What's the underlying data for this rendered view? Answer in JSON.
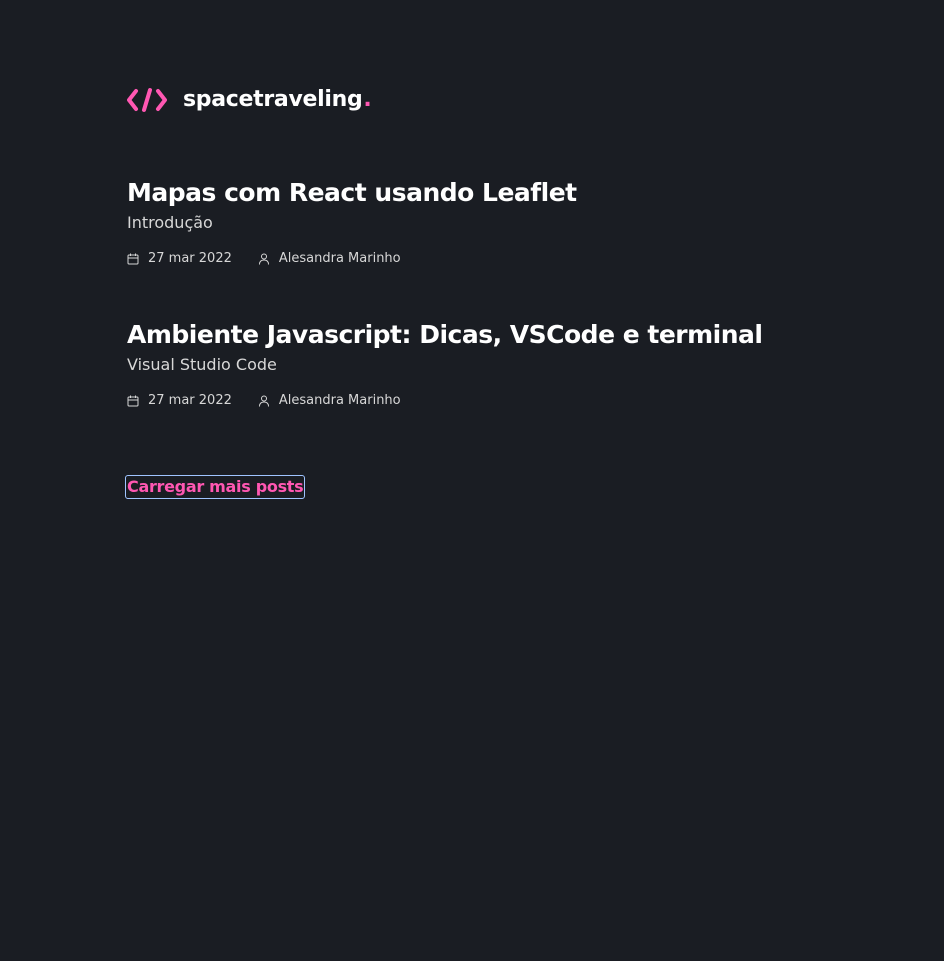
{
  "brand": {
    "name": "spacetraveling",
    "dot": ".",
    "logo_icon": "code-brackets-icon",
    "accent_color": "#ff57b2"
  },
  "posts": [
    {
      "title": "Mapas com React usando Leaflet",
      "subtitle": "Introdução",
      "date": "27 mar 2022",
      "author": "Alesandra Marinho"
    },
    {
      "title": "Ambiente Javascript: Dicas, VSCode e terminal",
      "subtitle": "Visual Studio Code",
      "date": "27 mar 2022",
      "author": "Alesandra Marinho"
    }
  ],
  "load_more_label": "Carregar mais posts",
  "icons": {
    "date": "calendar-icon",
    "author": "user-icon"
  },
  "colors": {
    "background": "#1a1d23",
    "text": "#ffffff",
    "muted": "#d7d7d7"
  }
}
